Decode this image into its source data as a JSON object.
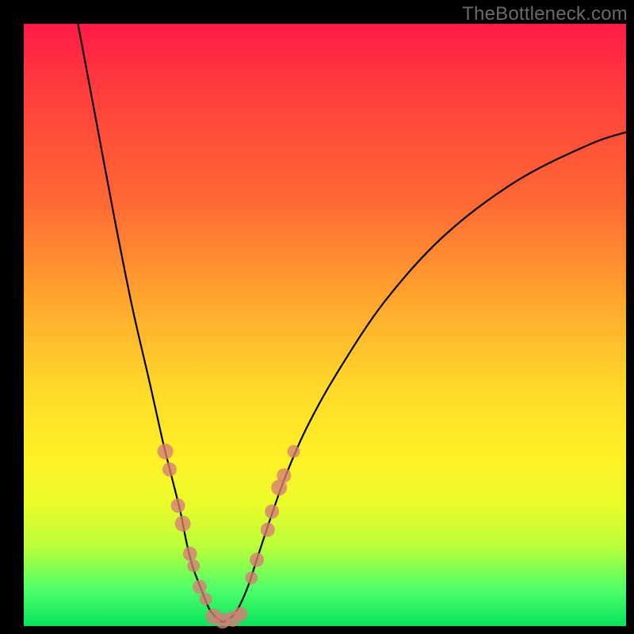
{
  "watermark": "TheBottleneck.com",
  "colors": {
    "frame": "#000000",
    "gradient_top": "#ff1a48",
    "gradient_mid": "#ffd82a",
    "gradient_bottom": "#07e35a",
    "curve": "#000000",
    "marker": "#d67c76"
  },
  "chart_data": {
    "type": "line",
    "title": "",
    "xlabel": "",
    "ylabel": "",
    "xlim": [
      0,
      100
    ],
    "ylim": [
      0,
      100
    ],
    "grid": false,
    "legend": false,
    "series": [
      {
        "name": "left-branch",
        "x": [
          9,
          12,
          15,
          18,
          21,
          23,
          24.5,
          26,
          27,
          28,
          29.5,
          31,
          33
        ],
        "y": [
          100,
          84,
          68,
          53,
          40,
          31,
          25,
          19,
          14,
          10,
          6,
          2.5,
          0.6
        ]
      },
      {
        "name": "right-branch",
        "x": [
          33,
          35,
          37,
          39,
          41,
          43.5,
          47,
          52,
          60,
          70,
          82,
          94,
          100
        ],
        "y": [
          0.6,
          2,
          6,
          12,
          18,
          25,
          33,
          42,
          54,
          65,
          74,
          80,
          82
        ]
      }
    ],
    "markers_left": [
      {
        "x": 23.5,
        "y": 29,
        "r": 10
      },
      {
        "x": 24.2,
        "y": 26,
        "r": 9
      },
      {
        "x": 25.6,
        "y": 20,
        "r": 9
      },
      {
        "x": 26.4,
        "y": 17,
        "r": 10
      },
      {
        "x": 27.6,
        "y": 12,
        "r": 9
      },
      {
        "x": 28.2,
        "y": 10,
        "r": 8
      },
      {
        "x": 29.2,
        "y": 6.5,
        "r": 9
      },
      {
        "x": 30.2,
        "y": 4.5,
        "r": 8
      }
    ],
    "markers_bottom": [
      {
        "x": 31.5,
        "y": 1.6,
        "r": 10
      },
      {
        "x": 33.0,
        "y": 0.9,
        "r": 10
      },
      {
        "x": 34.7,
        "y": 1.2,
        "r": 10
      },
      {
        "x": 36.0,
        "y": 2.0,
        "r": 9
      }
    ],
    "markers_right": [
      {
        "x": 37.8,
        "y": 8,
        "r": 8
      },
      {
        "x": 38.7,
        "y": 11,
        "r": 9
      },
      {
        "x": 40.5,
        "y": 16,
        "r": 9
      },
      {
        "x": 41.2,
        "y": 19,
        "r": 9
      },
      {
        "x": 42.4,
        "y": 23,
        "r": 10
      },
      {
        "x": 43.2,
        "y": 25,
        "r": 9
      },
      {
        "x": 44.8,
        "y": 29,
        "r": 8
      }
    ]
  }
}
